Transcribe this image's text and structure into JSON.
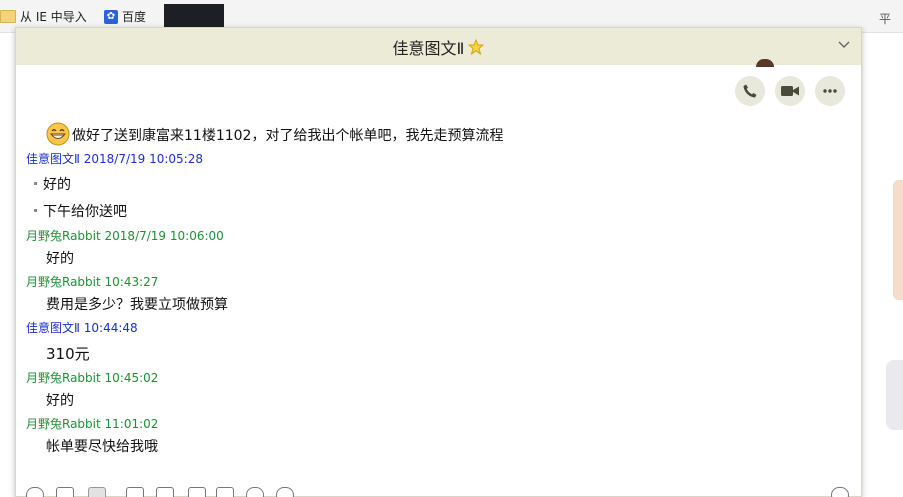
{
  "browser": {
    "bookmarks": [
      {
        "label": "从 IE 中导入",
        "icon": "folder-icon"
      },
      {
        "label": "百度",
        "icon": "baidu-paw-icon"
      }
    ],
    "edge_glyph": "平"
  },
  "window": {
    "title": "佳意图文Ⅱ",
    "title_icon": "star-icon",
    "actions": [
      {
        "name": "voice-call-button",
        "icon": "phone-icon"
      },
      {
        "name": "video-call-button",
        "icon": "video-camera-icon"
      },
      {
        "name": "more-button",
        "icon": "more-dots-icon"
      }
    ]
  },
  "colors": {
    "titlebar": "#ebebd8",
    "sender_green": "#1f8f36",
    "sender_blue": "#1a2fd6"
  },
  "chat": {
    "messages": [
      {
        "sender": "",
        "time": "",
        "text": "做好了送到康富来11楼1102，对了给我出个帐单吧，我先走预算流程",
        "emoji": "grin-emoji-icon"
      },
      {
        "sender": "佳意图文Ⅱ",
        "time": "2018/7/19 10:05:28",
        "lines": [
          "好的",
          "下午给你送吧"
        ]
      },
      {
        "sender": "月野兔Rabbit",
        "time": "2018/7/19 10:06:00",
        "text": "好的"
      },
      {
        "sender": "月野兔Rabbit",
        "time": "10:43:27",
        "text": "费用是多少？我要立项做预算"
      },
      {
        "sender": "佳意图文Ⅱ",
        "time": "10:44:48",
        "text": "310元"
      },
      {
        "sender": "月野兔Rabbit",
        "time": "10:45:02",
        "text": "好的"
      },
      {
        "sender": "月野兔Rabbit",
        "time": "11:01:02",
        "text": "帐单要尽快给我哦"
      }
    ]
  }
}
